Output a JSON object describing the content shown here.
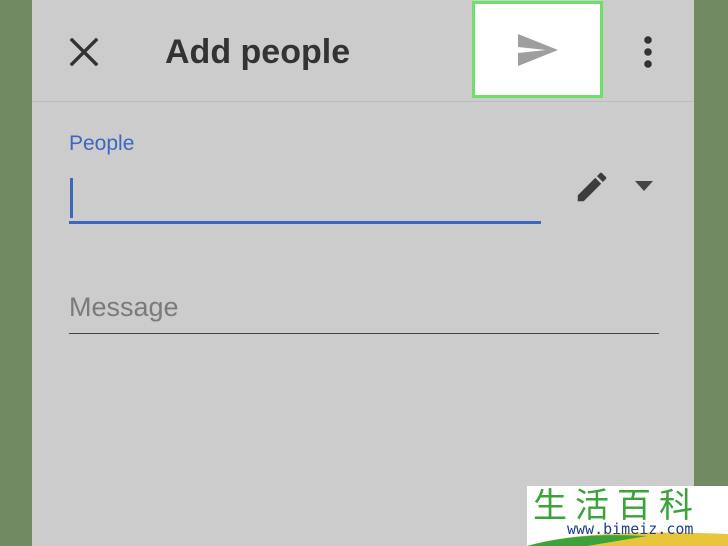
{
  "toolbar": {
    "title": "Add people",
    "close_icon": "close-icon",
    "send_icon": "send-icon",
    "more_icon": "more-vertical-icon"
  },
  "form": {
    "people_label": "People",
    "people_value": "",
    "message_placeholder": "Message",
    "pencil_icon": "pencil-icon",
    "dropdown_icon": "dropdown-arrow-icon"
  },
  "watermark": {
    "chinese": "生活百科",
    "url": "www.bimeiz.com"
  },
  "colors": {
    "background": "#718a62",
    "panel": "#cccccc",
    "accent_blue": "#3f66bf",
    "highlight_border": "#6ee06a",
    "text_dark": "#333333"
  }
}
